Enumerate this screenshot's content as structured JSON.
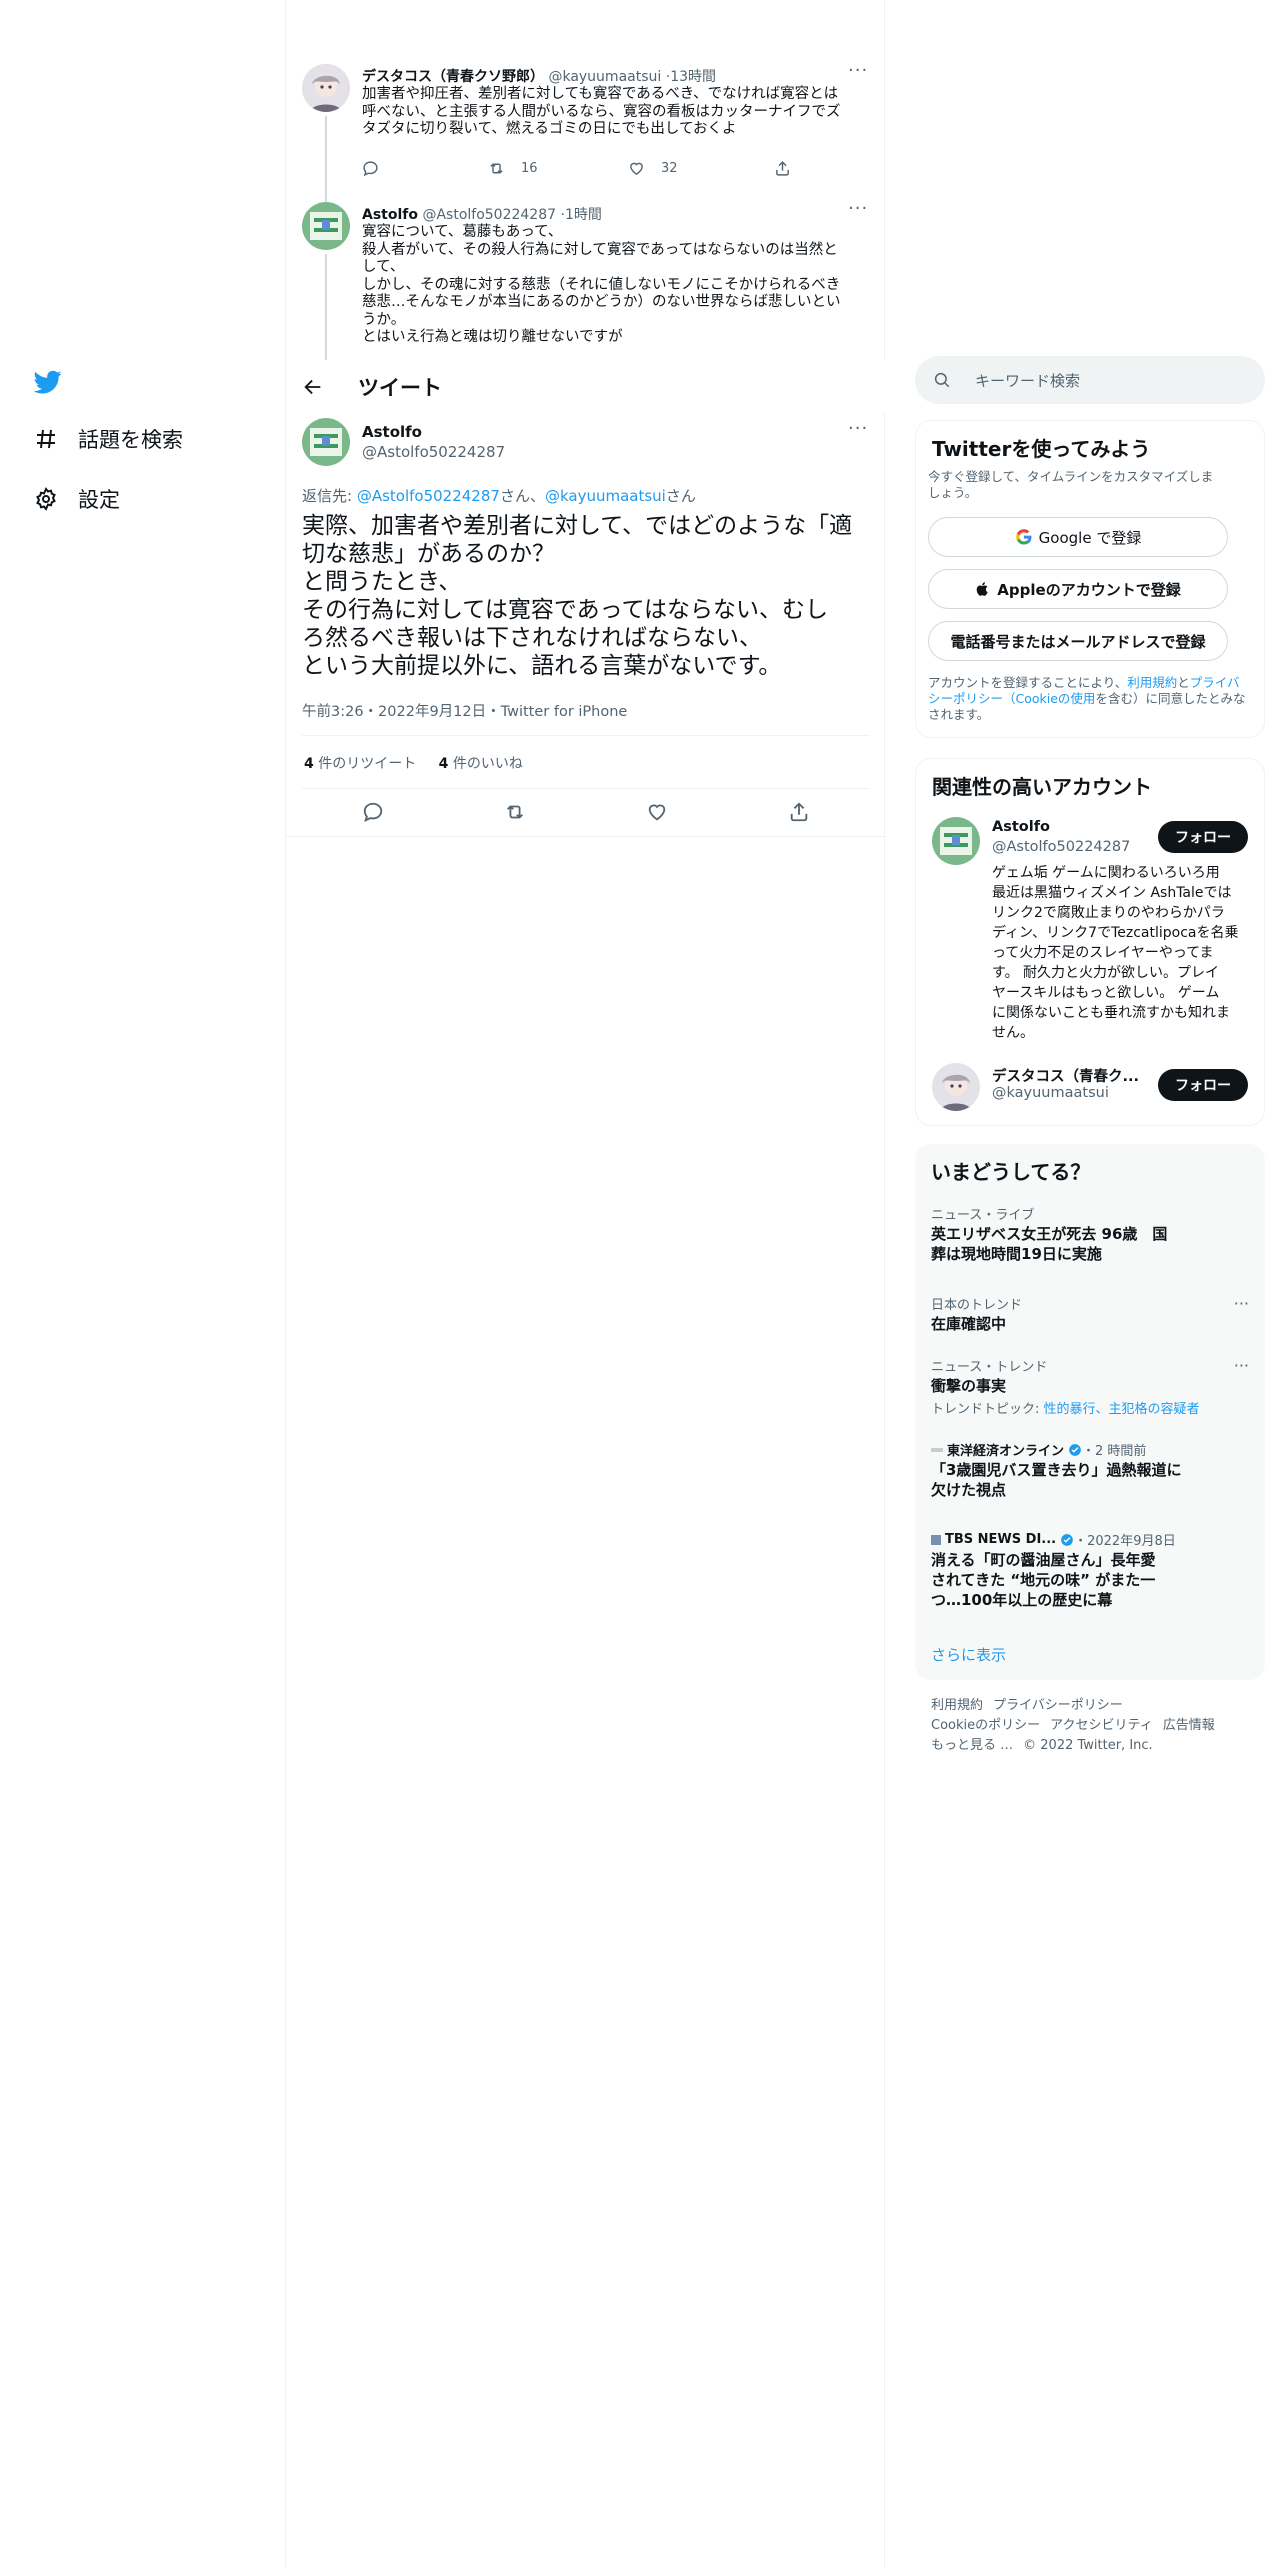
{
  "nav": {
    "items": [
      {
        "label": "話題を検索",
        "icon": "hashtag-icon"
      },
      {
        "label": "設定",
        "icon": "gear-icon"
      }
    ]
  },
  "thread": [
    {
      "name": "デスタコス（青春クソ野郎）",
      "handle": "@kayuumaatsui",
      "time": "13時間",
      "text": "加害者や抑圧者、差別者に対しても寛容であるべき、でなければ寛容とは\n呼べない、と主張する人間がいるなら、寛容の看板はカッターナイフでズ\nタズタに切り裂いて、燃えるゴミの日にでも出しておくよ",
      "retweets": "16",
      "likes": "32"
    },
    {
      "name": "Astolfo",
      "handle": "@Astolfo50224287",
      "time": "1時間",
      "text": "寛容について、葛藤もあって、\n殺人者がいて、その殺人行為に対して寛容であってはならないのは当然と\nして、\nしかし、その魂に対する慈悲（それに値しないモノにこそかけられるべき\n慈悲…そんなモノが本当にあるのかどうか）のない世界ならば悲しいとい\nうか。\nとはいえ行為と魂は切り離せないですが"
    }
  ],
  "header": {
    "title": "ツイート"
  },
  "main_tweet": {
    "name": "Astolfo",
    "handle": "@Astolfo50224287",
    "reply_prefix": "返信先: ",
    "reply_to_1": "@Astolfo50224287",
    "reply_san_1": "さん、",
    "reply_to_2": "@kayuumaatsui",
    "reply_san_2": "さん",
    "text": "実際、加害者や差別者に対して、ではどのような「適\n切な慈悲」があるのか？\nと問うたとき、\nその行為に対しては寛容であってはならない、むし\nろ然るべき報いは下されなければならない、\nという大前提以外に、語れる言葉がないです。",
    "meta": "午前3:26・2022年9月12日・Twitter for iPhone",
    "retweet_count": "4",
    "retweet_label": " 件のリツイート",
    "like_count": "4",
    "like_label": " 件のいいね"
  },
  "search": {
    "placeholder": "キーワード検索"
  },
  "signup": {
    "title": "Twitterを使ってみよう",
    "subtitle": "今すぐ登録して、タイムラインをカスタマイズしま\nしょう。",
    "google": "Google で登録",
    "apple": "Appleのアカウントで登録",
    "phone": "電話番号またはメールアドレスで登録",
    "legal_1": "アカウントを登録することにより、",
    "legal_tos": "利用規約",
    "legal_2": "と",
    "legal_privacy": "プライバシーポリシー（Cookieの使用",
    "legal_3": "を含む）に同意したとみなされます。"
  },
  "relevant": {
    "title": "関連性の高いアカウント",
    "accounts": [
      {
        "name": "Astolfo",
        "handle": "@Astolfo50224287",
        "bio": "ゲェム垢 ゲームに関わるいろいろ用\n最近は黒猫ウィズメイン AshTaleでは\nリンク2で腐敗止まりのやわらかパラ\nディン、リンク7でTezcatlipocaを名乗\nって火力不足のスレイヤーやってま\nす。 耐久力と火力が欲しい。プレイ\nヤースキルはもっと欲しい。 ゲーム\nに関係ないことも垂れ流すかも知れま\nせん。",
        "follow": "フォロー"
      },
      {
        "name": "デスタコス（青春ク...",
        "handle": "@kayuumaatsui",
        "follow": "フォロー"
      }
    ]
  },
  "trends": {
    "title": "いまどうしてる？",
    "items": [
      {
        "category": "ニュース・ライブ",
        "name": "英エリザベス女王が死去 96歳　国\n葬は現地時間19日に実施"
      },
      {
        "category": "日本のトレンド",
        "name": "在庫確認中"
      },
      {
        "category": "ニュース・トレンド",
        "name": "衝撃の事実",
        "topics_prefix": "トレンドトピック: ",
        "topics": "性的暴行、主犯格の容疑者"
      },
      {
        "source": "東洋経済オンライン",
        "time": "・2 時間前",
        "name": "「3歳園児バス置き去り」過熱報道に\n欠けた視点"
      },
      {
        "source": "TBS NEWS DI...",
        "time": "・2022年9月8日",
        "name": "消える「町の醤油屋さん」長年愛\nされてきた “地元の味” がまた一\nつ…100年以上の歴史に幕"
      }
    ],
    "more": "さらに表示"
  },
  "footer": {
    "links_1": [
      "利用規約",
      "プライバシーポリシー"
    ],
    "links_2": [
      "Cookieのポリシー",
      "アクセシビリティ",
      "広告情報"
    ],
    "more": "もっと見る …",
    "copyright": "© 2022 Twitter, Inc."
  }
}
